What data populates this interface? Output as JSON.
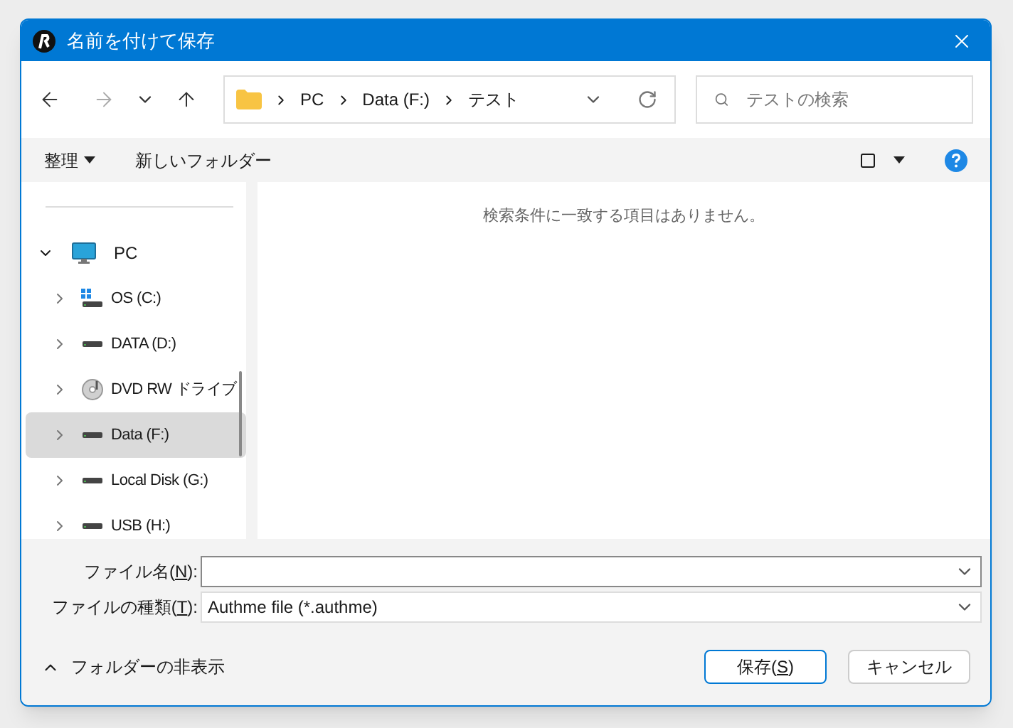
{
  "window": {
    "title": "名前を付けて保存"
  },
  "nav": {
    "back_disabled": false,
    "forward_disabled": true
  },
  "breadcrumb": [
    "PC",
    "Data (F:)",
    "テスト"
  ],
  "search": {
    "placeholder": "テストの検索"
  },
  "toolbar": {
    "organize": "整理",
    "new_folder": "新しいフォルダー"
  },
  "sidebar": {
    "items": [
      {
        "label": "PC",
        "kind": "computer",
        "expanded": true,
        "selected": false,
        "children": [
          {
            "label": "OS (C:)",
            "kind": "system-drive",
            "expanded": false,
            "selected": false
          },
          {
            "label": "DATA (D:)",
            "kind": "drive",
            "expanded": false,
            "selected": false
          },
          {
            "label": "DVD RW ドライブ",
            "kind": "dvd",
            "expanded": false,
            "selected": false
          },
          {
            "label": "Data (F:)",
            "kind": "drive",
            "expanded": false,
            "selected": true
          },
          {
            "label": "Local Disk (G:)",
            "kind": "drive",
            "expanded": false,
            "selected": false
          },
          {
            "label": "USB (H:)",
            "kind": "drive",
            "expanded": false,
            "selected": false
          }
        ]
      }
    ]
  },
  "empty_message": "検索条件に一致する項目はありません。",
  "fields": [
    {
      "label_before": "ファイル名(",
      "access_key": "N",
      "label_after": "):",
      "focused": true
    },
    {
      "label_before": "ファイルの種類(",
      "access_key": "T",
      "label_after": "):",
      "value": "Authme file (*.authme)",
      "focused": false
    }
  ],
  "hide_folders": "フォルダーの非表示",
  "buttons": [
    {
      "label_before": "保存(",
      "access_key": "S",
      "label_after": ")",
      "default": true
    },
    {
      "label_before": "キャンセル",
      "default": false
    }
  ]
}
